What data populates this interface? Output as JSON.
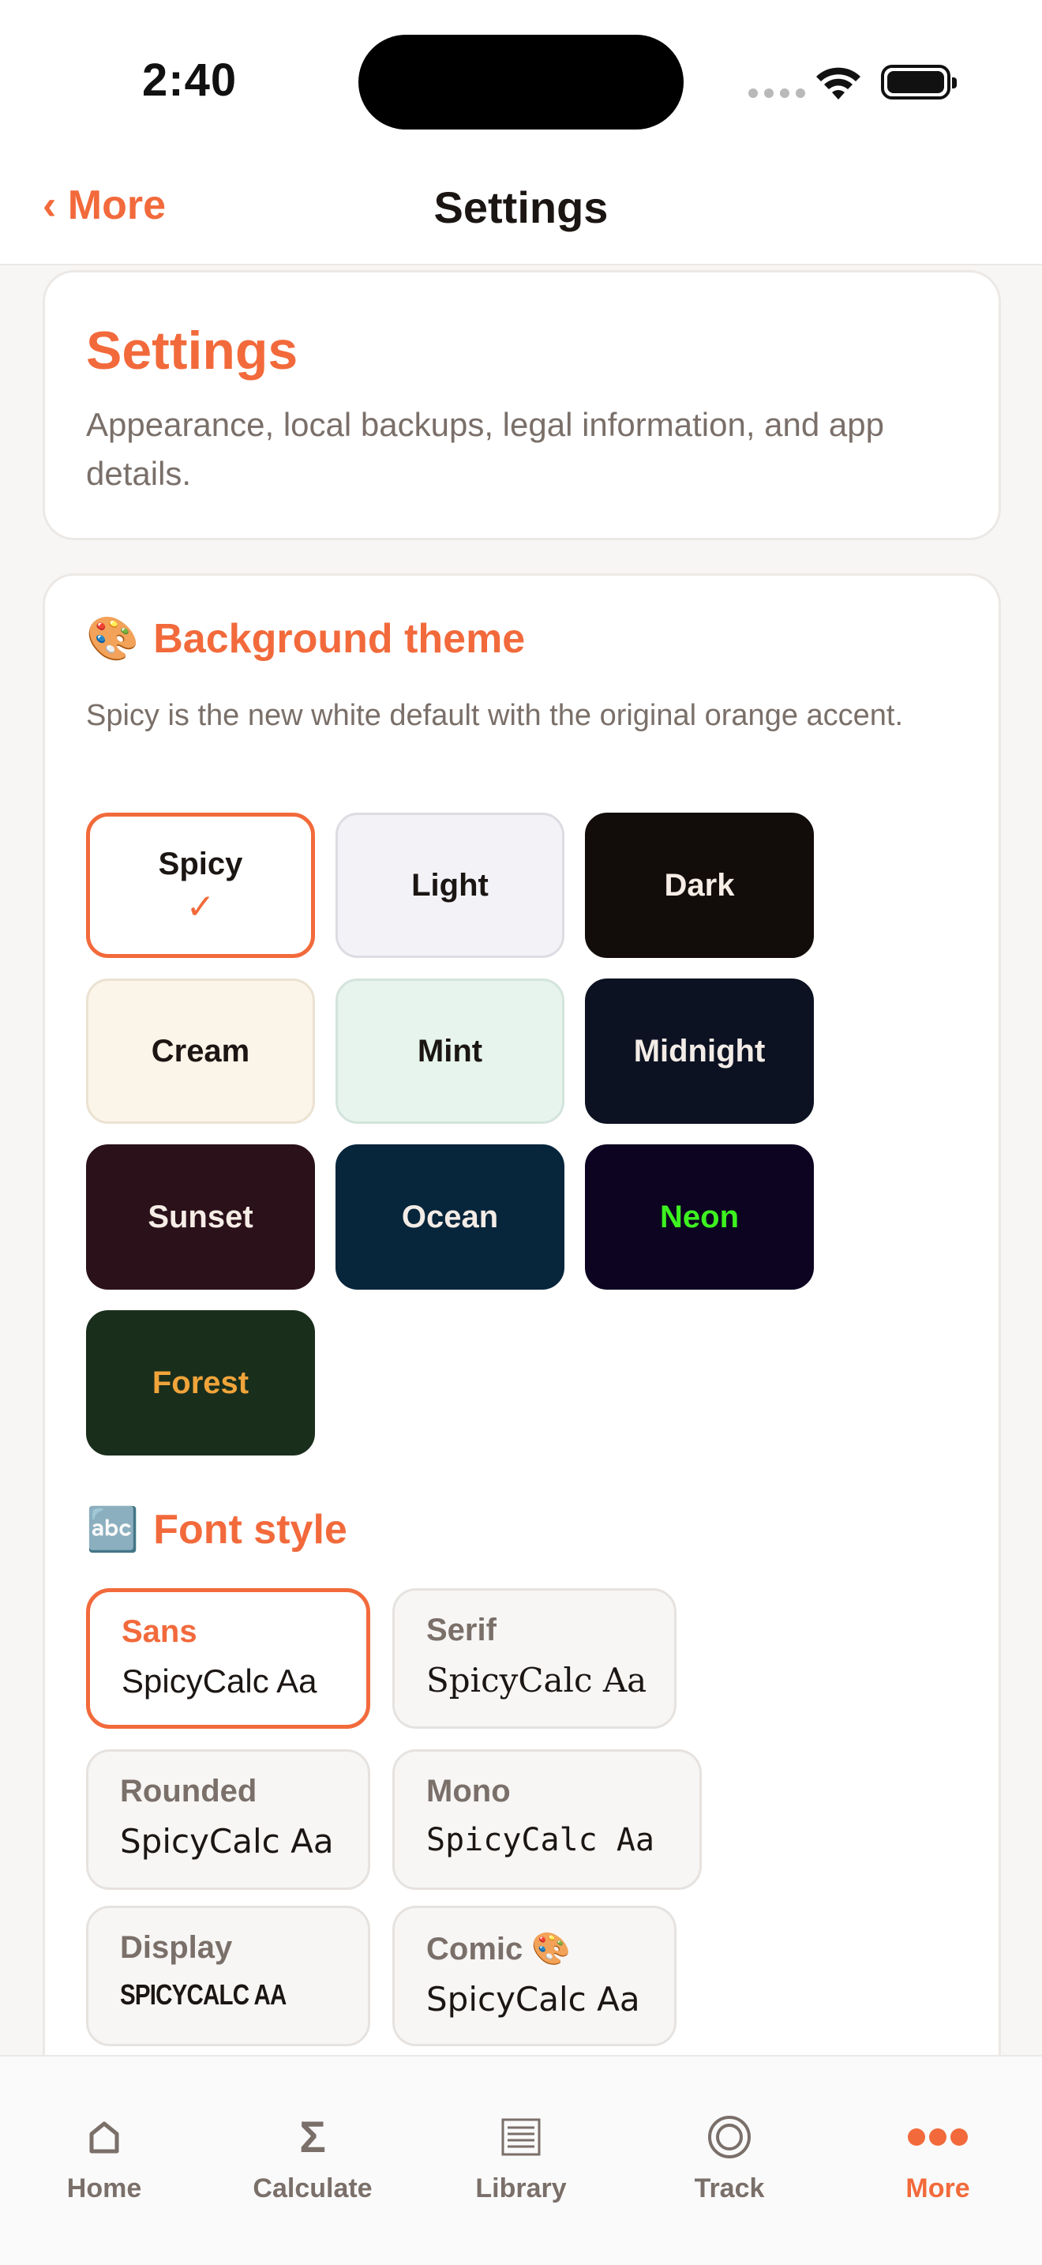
{
  "status_bar": {
    "time": "2:40"
  },
  "nav": {
    "back_label": "‹ More",
    "title": "Settings"
  },
  "header": {
    "title": "Settings",
    "subtitle": "Appearance, local backups, legal information, and app details."
  },
  "theme_section": {
    "icon": "🎨",
    "title": "Background theme",
    "description": "Spicy is the new white default with the original orange accent.",
    "selected": "Spicy",
    "themes": [
      {
        "label": "Spicy",
        "bg": "#ffffff",
        "fg": "#1b1613",
        "border": "#f26a3b",
        "selected": true
      },
      {
        "label": "Light",
        "bg": "#f2f2f7",
        "fg": "#1b1613",
        "border": "#dcdce2",
        "selected": false
      },
      {
        "label": "Dark",
        "bg": "#120c0a",
        "fg": "#f6ede6",
        "border": "#120c0a",
        "selected": false
      },
      {
        "label": "Cream",
        "bg": "#fbf4e8",
        "fg": "#1b1613",
        "border": "#ebe2d2",
        "selected": false
      },
      {
        "label": "Mint",
        "bg": "#e7f4ee",
        "fg": "#1b1613",
        "border": "#d3e4dc",
        "selected": false
      },
      {
        "label": "Midnight",
        "bg": "#0c1222",
        "fg": "#f3ece6",
        "border": "#0c1222",
        "selected": false
      },
      {
        "label": "Sunset",
        "bg": "#2b1119",
        "fg": "#f6ede6",
        "border": "#2b1119",
        "selected": false
      },
      {
        "label": "Ocean",
        "bg": "#07253b",
        "fg": "#f3ece6",
        "border": "#07253b",
        "selected": false
      },
      {
        "label": "Neon",
        "bg": "#0d0422",
        "fg": "#3df21f",
        "border": "#0d0422",
        "selected": false
      },
      {
        "label": "Forest",
        "bg": "#1a2e1c",
        "fg": "#f0a43a",
        "border": "#1a2e1c",
        "selected": false
      }
    ],
    "check_icon": "✓"
  },
  "font_section": {
    "icon": "🔤",
    "title": "Font style",
    "selected": "Sans",
    "fonts": [
      {
        "name": "Sans",
        "sample": "SpicyCalc Aa",
        "selected": true
      },
      {
        "name": "Serif",
        "sample": "SpicyCalc Aa",
        "selected": false
      },
      {
        "name": "Rounded",
        "sample": "SpicyCalc Aa",
        "selected": false
      },
      {
        "name": "Mono",
        "sample": "SpicyCalc Aa",
        "selected": false
      },
      {
        "name": "Display",
        "sample": "SPICYCALC AA",
        "selected": false
      },
      {
        "name": "Comic 🎨",
        "sample": "SpicyCalc Aa",
        "selected": false
      }
    ]
  },
  "tab_bar": {
    "active": "More",
    "tabs": [
      {
        "label": "Home",
        "icon": "home-icon"
      },
      {
        "label": "Calculate",
        "icon": "sigma-icon"
      },
      {
        "label": "Library",
        "icon": "library-icon"
      },
      {
        "label": "Track",
        "icon": "target-icon"
      },
      {
        "label": "More",
        "icon": "ellipsis-icon"
      }
    ]
  },
  "colors": {
    "accent": "#f26a3b",
    "muted_text": "#7a6f69",
    "page_bg": "#f7f6f5"
  }
}
